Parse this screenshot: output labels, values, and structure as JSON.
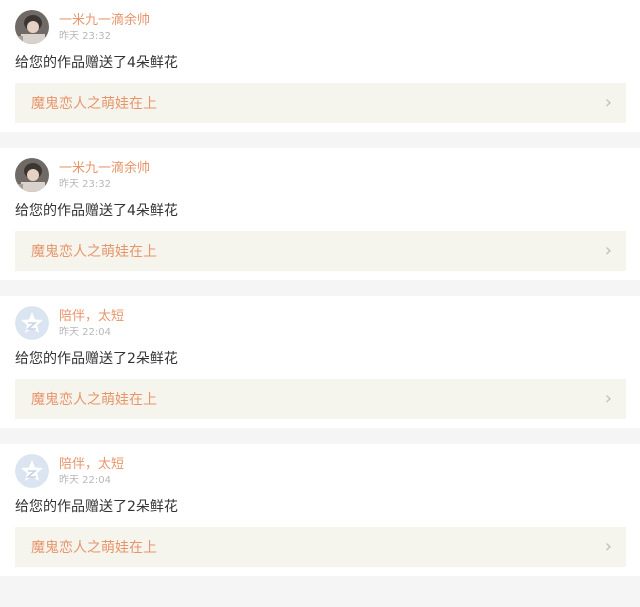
{
  "notifications": [
    {
      "user": "一米九一滴余帅",
      "time": "昨天 23:32",
      "message": "给您的作品赠送了4朵鲜花",
      "work_title": "魔鬼恋人之萌娃在上",
      "avatar": "user-photo-avatar"
    },
    {
      "user": "一米九一滴余帅",
      "time": "昨天 23:32",
      "message": "给您的作品赠送了4朵鲜花",
      "work_title": "魔鬼恋人之萌娃在上",
      "avatar": "user-photo-avatar"
    },
    {
      "user": "陪伴，太短",
      "time": "昨天 22:04",
      "message": "给您的作品赠送了2朵鲜花",
      "work_title": "魔鬼恋人之萌娃在上",
      "avatar": "default-star-avatar"
    },
    {
      "user": "陪伴，太短",
      "time": "昨天 22:04",
      "message": "给您的作品赠送了2朵鲜花",
      "work_title": "魔鬼恋人之萌娃在上",
      "avatar": "default-star-avatar"
    }
  ],
  "icons": {
    "chevron": "chevron-right-icon"
  },
  "colors": {
    "accent": "#e8956a",
    "timestamp": "#b8b8b8",
    "text": "#333333",
    "work_bg": "#f5f5ee",
    "page_bg": "#f6f5f5",
    "default_avatar": "#dbe5f2"
  }
}
